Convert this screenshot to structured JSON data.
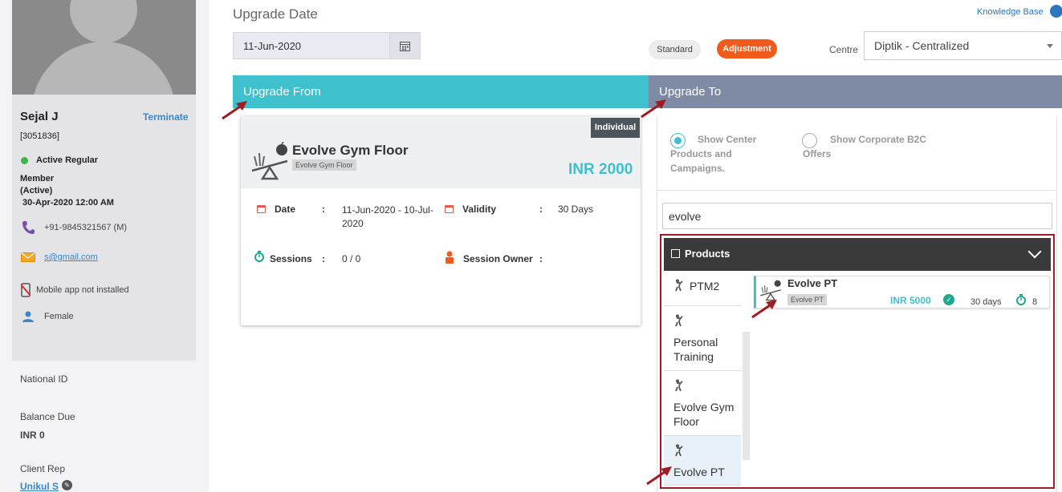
{
  "client": {
    "name": "Sejal J",
    "terminate_label": "Terminate",
    "id": "[3051836]",
    "status": "Active Regular",
    "member_line1": "Member",
    "member_line2": "(Active)",
    "member_since": "30-Apr-2020 12:00 AM",
    "phone": "+91-9845321567 (M)",
    "email": "s@gmail.com",
    "app_status": "Mobile app not installed",
    "gender": "Female",
    "national_id_label": "National ID",
    "balance_label": "Balance Due",
    "balance_value": "INR 0",
    "rep_label": "Client Rep",
    "rep_name": "Unikul S"
  },
  "header": {
    "upgrade_date_label": "Upgrade Date",
    "upgrade_date_value": "11-Jun-2020",
    "kb_label": "Knowledge Base",
    "standard_label": "Standard",
    "adjustment_label": "Adjustment",
    "centre_label": "Centre",
    "centre_value": "Diptik - Centralized"
  },
  "upgrade_from": {
    "title": "Upgrade From",
    "badge": "Individual",
    "package_name": "Evolve Gym Floor",
    "package_tag": "Evolve Gym Floor",
    "price": "INR 2000",
    "date_label": "Date",
    "date_value": "11-Jun-2020 - 10-Jul-2020",
    "validity_label": "Validity",
    "validity_value": "30 Days",
    "sessions_label": "Sessions",
    "sessions_value": "0 / 0",
    "owner_label": "Session Owner",
    "colon": ":"
  },
  "upgrade_to": {
    "title": "Upgrade To",
    "option1": "Show Center Products and Campaigns.",
    "option2": "Show Corporate B2C Offers",
    "search_value": "evolve",
    "products_label": "Products",
    "categories": [
      {
        "label": "PTM2"
      },
      {
        "label": "Personal Training"
      },
      {
        "label": "Evolve Gym Floor"
      },
      {
        "label": "Evolve PT"
      }
    ],
    "product": {
      "name": "Evolve PT",
      "tag": "Evolve PT",
      "price": "INR 5000",
      "days": "30 days",
      "sessions": "8"
    }
  },
  "colors": {
    "teal": "#3fc0cd",
    "slate": "#7f8ba4",
    "orange": "#f05a1a",
    "annotation_red": "#a01c22"
  }
}
